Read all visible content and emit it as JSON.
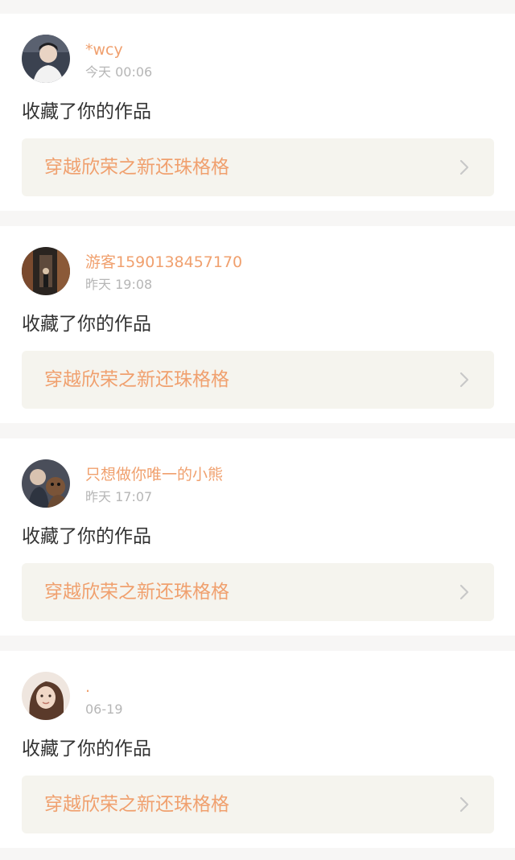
{
  "colors": {
    "accent": "#f0a06e",
    "page_background": "#f7f6f5",
    "card_background": "#ffffff",
    "work_background": "#f5f4ee",
    "time_text": "#b6b6b6",
    "action_text": "#333333",
    "chevron": "#c8c8c8"
  },
  "notifications": [
    {
      "username": "*wcy",
      "time": "今天 00:06",
      "action": "收藏了你的作品",
      "work_title": "穿越欣荣之新还珠格格",
      "avatar_icon": "user-avatar-photo-icon"
    },
    {
      "username": "游客1590138457170",
      "time": "昨天 19:08",
      "action": "收藏了你的作品",
      "work_title": "穿越欣荣之新还珠格格",
      "avatar_icon": "user-avatar-photo-icon"
    },
    {
      "username": "只想做你唯一的小熊",
      "time": "昨天 17:07",
      "action": "收藏了你的作品",
      "work_title": "穿越欣荣之新还珠格格",
      "avatar_icon": "user-avatar-photo-icon"
    },
    {
      "username": ".",
      "time": "06-19",
      "action": "收藏了你的作品",
      "work_title": "穿越欣荣之新还珠格格",
      "avatar_icon": "user-avatar-photo-icon"
    }
  ]
}
